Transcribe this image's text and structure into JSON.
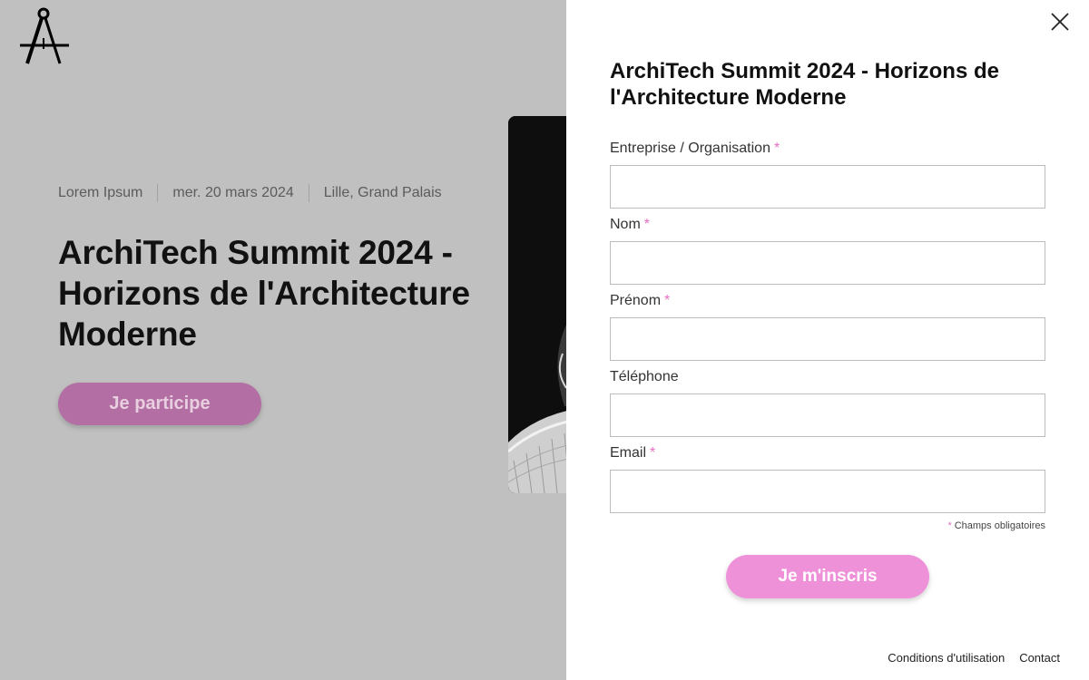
{
  "background_page": {
    "meta": {
      "category": "Lorem Ipsum",
      "date": "mer. 20 mars 2024",
      "location": "Lille, Grand Palais"
    },
    "hero_title": "ArchiTech Summit 2024 - Horizons de l'Architecture Moderne",
    "cta_label": "Je participe"
  },
  "drawer": {
    "title": "ArchiTech Summit 2024 - Horizons de l'Architecture Moderne",
    "fields": {
      "company": {
        "label": "Entreprise / Organisation",
        "required_mark": "*",
        "value": ""
      },
      "last_name": {
        "label": "Nom",
        "required_mark": "*",
        "value": ""
      },
      "first_name": {
        "label": "Prénom",
        "required_mark": "*",
        "value": ""
      },
      "phone": {
        "label": "Téléphone",
        "value": ""
      },
      "email": {
        "label": "Email",
        "required_mark": "*",
        "value": ""
      }
    },
    "required_note": {
      "mark": "*",
      "text": "Champs obligatoires"
    },
    "submit_label": "Je m'inscris",
    "footer": {
      "terms": "Conditions d'utilisation",
      "contact": "Contact"
    }
  },
  "colors": {
    "accent_pink": "#ee91d9",
    "dimmed_accent": "#b36ea3",
    "overlay_gray": "#c0c0c0"
  },
  "icons": {
    "logo": "drafting-compass-icon",
    "close": "close-icon"
  }
}
